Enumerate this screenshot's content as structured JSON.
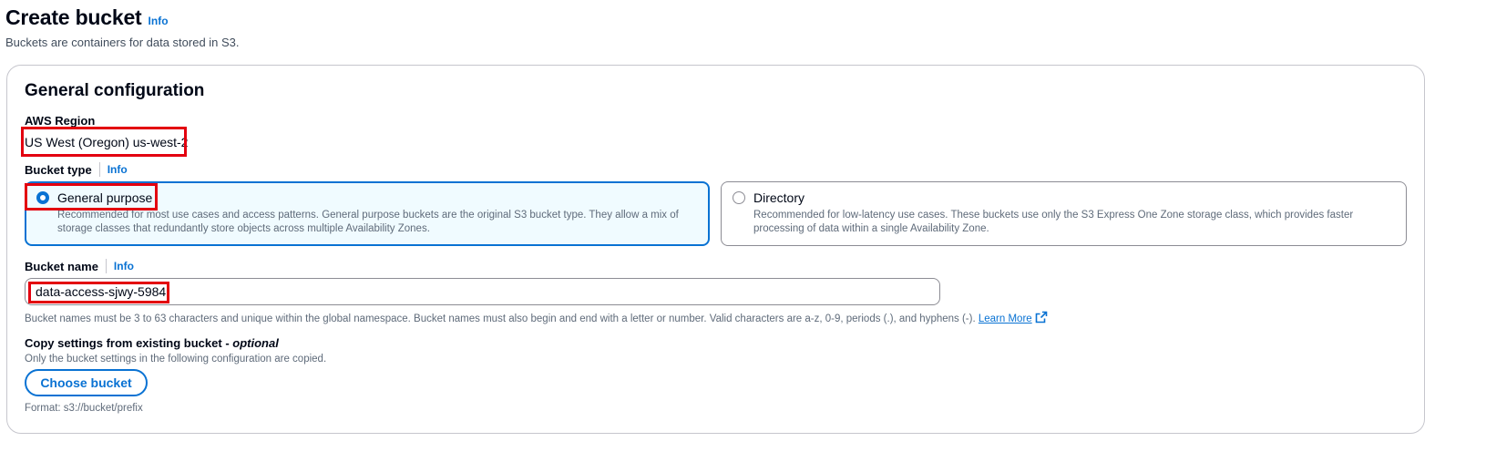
{
  "header": {
    "title": "Create bucket",
    "info": "Info",
    "description": "Buckets are containers for data stored in S3."
  },
  "general": {
    "title": "General configuration",
    "region_label": "AWS Region",
    "region_value": "US West (Oregon) us-west-2",
    "bucket_type_label": "Bucket type",
    "bucket_type_info": "Info",
    "options": [
      {
        "title": "General purpose",
        "description": "Recommended for most use cases and access patterns. General purpose buckets are the original S3 bucket type. They allow a mix of storage classes that redundantly store objects across multiple Availability Zones.",
        "selected": true
      },
      {
        "title": "Directory",
        "description": "Recommended for low-latency use cases. These buckets use only the S3 Express One Zone storage class, which provides faster processing of data within a single Availability Zone.",
        "selected": false
      }
    ],
    "bucket_name_label": "Bucket name",
    "bucket_name_info": "Info",
    "bucket_name_value": "data-access-sjwy-5984",
    "bucket_name_hint": "Bucket names must be 3 to 63 characters and unique within the global namespace. Bucket names must also begin and end with a letter or number. Valid characters are a-z, 0-9, periods (.), and hyphens (-).",
    "learn_more": "Learn More",
    "copy_label": "Copy settings from existing bucket - ",
    "copy_optional": "optional",
    "copy_description": "Only the bucket settings in the following configuration are copied.",
    "choose_bucket": "Choose bucket",
    "format_hint": "Format: s3://bucket/prefix"
  },
  "colors": {
    "accent": "#0972d3",
    "highlight": "#e3000f",
    "text": "#000716",
    "muted": "#5f6b7a"
  },
  "icons": {
    "external_link": "external-link-icon"
  }
}
